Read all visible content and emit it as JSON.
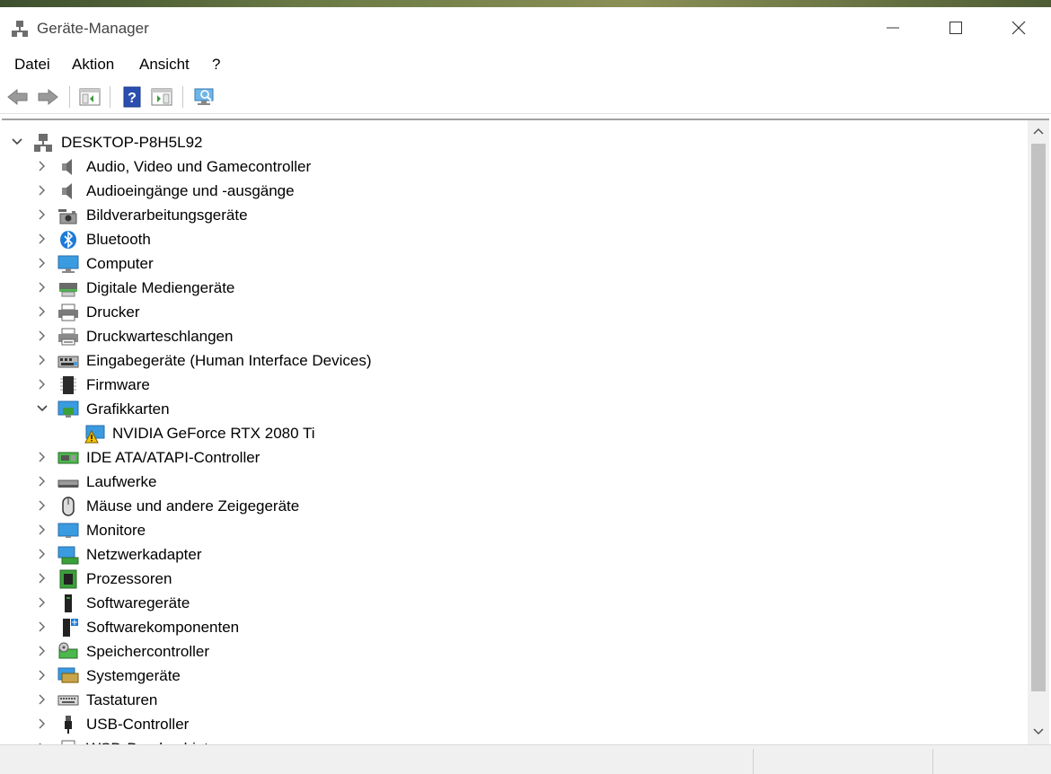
{
  "window": {
    "title": "Geräte-Manager",
    "minimize_label": "—",
    "maximize_label": "☐",
    "close_label": "✕"
  },
  "menu": [
    "Datei",
    "Aktion",
    "Ansicht",
    "?"
  ],
  "toolbar": [
    "back-arrow-icon",
    "forward-arrow-icon",
    "show-hide-console-tree-icon",
    "help-icon",
    "properties-icon",
    "scan-hardware-icon"
  ],
  "tree": {
    "root": "DESKTOP-P8H5L92",
    "items": [
      {
        "label": "Audio, Video und Gamecontroller",
        "icon": "speaker-icon"
      },
      {
        "label": "Audioeingänge und -ausgänge",
        "icon": "speaker-icon"
      },
      {
        "label": "Bildverarbeitungsgeräte",
        "icon": "camera-icon"
      },
      {
        "label": "Bluetooth",
        "icon": "bluetooth-icon"
      },
      {
        "label": "Computer",
        "icon": "computer-icon"
      },
      {
        "label": "Digitale Mediengeräte",
        "icon": "media-device-icon"
      },
      {
        "label": "Drucker",
        "icon": "printer-icon"
      },
      {
        "label": "Druckwarteschlangen",
        "icon": "print-queue-icon"
      },
      {
        "label": "Eingabegeräte (Human Interface Devices)",
        "icon": "hid-icon"
      },
      {
        "label": "Firmware",
        "icon": "firmware-icon"
      },
      {
        "label": "Grafikkarten",
        "icon": "display-adapter-icon",
        "expanded": true,
        "children": [
          {
            "label": "NVIDIA GeForce RTX 2080 Ti",
            "icon": "warning-display-icon"
          }
        ]
      },
      {
        "label": "IDE ATA/ATAPI-Controller",
        "icon": "ide-controller-icon"
      },
      {
        "label": "Laufwerke",
        "icon": "drive-icon"
      },
      {
        "label": "Mäuse und andere Zeigegeräte",
        "icon": "mouse-icon"
      },
      {
        "label": "Monitore",
        "icon": "monitor-icon"
      },
      {
        "label": "Netzwerkadapter",
        "icon": "network-adapter-icon"
      },
      {
        "label": "Prozessoren",
        "icon": "processor-icon"
      },
      {
        "label": "Softwaregeräte",
        "icon": "software-device-icon"
      },
      {
        "label": "Softwarekomponenten",
        "icon": "software-component-icon"
      },
      {
        "label": "Speichercontroller",
        "icon": "storage-controller-icon"
      },
      {
        "label": "Systemgeräte",
        "icon": "system-device-icon"
      },
      {
        "label": "Tastaturen",
        "icon": "keyboard-icon"
      },
      {
        "label": "USB-Controller",
        "icon": "usb-icon"
      },
      {
        "label": "WSD-Druckanbieter",
        "icon": "wsd-printer-icon"
      }
    ]
  },
  "colors": {
    "accent_blue": "#1e7bd6",
    "warning_yellow": "#f5c400",
    "chevron": "#555555"
  }
}
